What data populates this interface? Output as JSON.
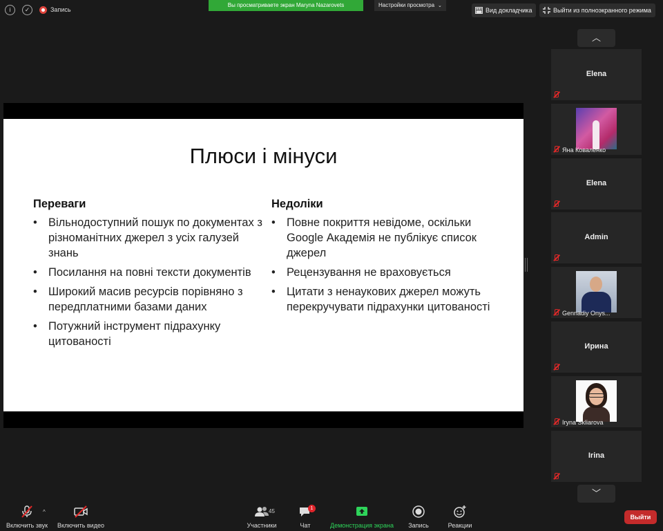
{
  "topbar": {
    "record_label": "Запись",
    "share_banner": "Вы просматриваете экран Maryna Nazarovets",
    "view_settings": "Настройки просмотра",
    "speaker_view": "Вид докладчика",
    "exit_fullscreen": "Выйти из полноэкранного режима"
  },
  "slide": {
    "title": "Плюси і мінуси",
    "pros": {
      "heading": "Переваги",
      "items": [
        "Вільнодоступний пошук по документах з різноманітних джерел з усіх галузей знань",
        "Посилання на повні тексти документів",
        "Широкий масив ресурсів порівняно з передплатними базами даних",
        "Потужний інструмент підрахунку цитованості"
      ]
    },
    "cons": {
      "heading": "Недоліки",
      "items": [
        "Повне покриття невідоме, оскільки Google Академія не публікує список джерел",
        "Рецензування не враховується",
        "Цитати з ненаукових джерел можуть перекручувати підрахунки цитованості"
      ]
    }
  },
  "gallery": {
    "participants": [
      {
        "name": "Elena",
        "label": ""
      },
      {
        "name": "",
        "label": "Яна Коваленко",
        "photo": "yana"
      },
      {
        "name": "Elena",
        "label": ""
      },
      {
        "name": "Admin",
        "label": ""
      },
      {
        "name": "",
        "label": "Gennadiy Onys...",
        "photo": "gennadiy"
      },
      {
        "name": "Ирина",
        "label": ""
      },
      {
        "name": "",
        "label": "Iryna Skliarova",
        "photo": "iryna"
      },
      {
        "name": "Irina",
        "label": ""
      }
    ]
  },
  "toolbar": {
    "unmute": "Включить звук",
    "start_video": "Включить видео",
    "participants": "Участники",
    "participants_count": "45",
    "chat": "Чат",
    "chat_badge": "1",
    "share_screen": "Демонстрация экрана",
    "record": "Запись",
    "reactions": "Реакции",
    "leave": "Выйти"
  },
  "colors": {
    "banner_green": "#31a837",
    "leave_red": "#c42b2b",
    "share_green": "#2ed45a",
    "muted_red": "#e02828"
  }
}
